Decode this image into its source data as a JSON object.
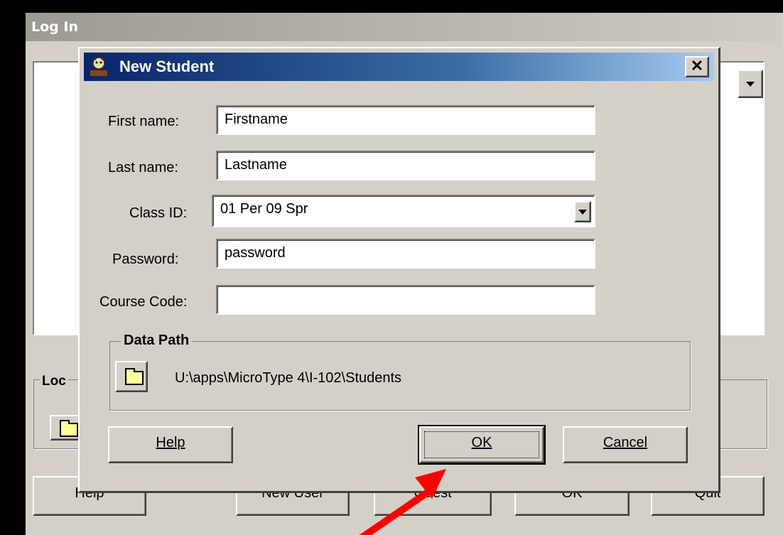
{
  "login_window": {
    "title": "Log In",
    "location_label": "Loc",
    "buttons": {
      "help": "Help",
      "new_user": "New User",
      "guest": "Guest",
      "ok": "OK",
      "quit": "Quit"
    }
  },
  "dialog": {
    "title": "New Student",
    "close_glyph": "✕",
    "fields": {
      "first_name": {
        "label": "First name:",
        "value": "Firstname"
      },
      "last_name": {
        "label": "Last name:",
        "value": "Lastname"
      },
      "class_id": {
        "label": "Class ID:",
        "value": "01 Per 09 Spr"
      },
      "password": {
        "label": "Password:",
        "value": "password"
      },
      "course_code": {
        "label": "Course Code:",
        "value": ""
      }
    },
    "data_path": {
      "legend": "Data Path",
      "path": "U:\\apps\\MicroType 4\\I-102\\Students"
    },
    "buttons": {
      "help": "Help",
      "ok": "OK",
      "cancel": "Cancel"
    }
  },
  "colors": {
    "face": "#d4d0c8",
    "titlebar_start": "#0a246a",
    "titlebar_end": "#a6caf0",
    "arrow": "#ff0000"
  }
}
